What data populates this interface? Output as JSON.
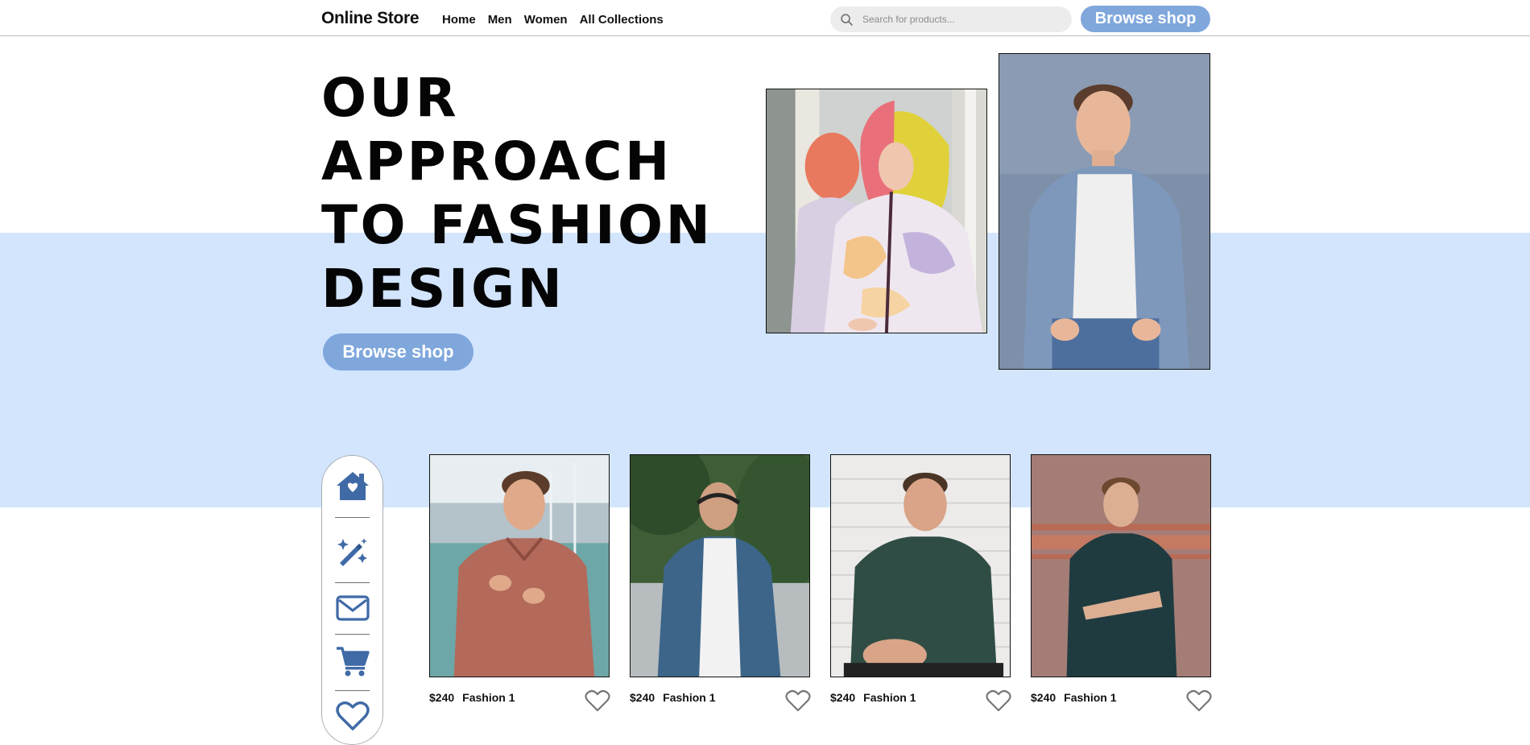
{
  "header": {
    "brand": "Online Store",
    "nav": [
      "Home",
      "Men",
      "Women",
      "All Collections"
    ],
    "search": {
      "placeholder": "Search for products...",
      "icon": "search-icon"
    },
    "cta_label": "Browse shop"
  },
  "hero": {
    "title_lines": [
      "OUR",
      "APPROACH",
      "TO FASHION",
      "DESIGN"
    ],
    "cta_label": "Browse shop",
    "photos": [
      "tie-dye-jacket-photo",
      "denim-shirt-man-photo"
    ]
  },
  "side_nav": {
    "items": [
      {
        "icon": "home-icon"
      },
      {
        "icon": "magic-wand-icon"
      },
      {
        "icon": "envelope-icon"
      },
      {
        "icon": "cart-icon"
      },
      {
        "icon": "heart-icon"
      }
    ]
  },
  "products": [
    {
      "price": "$240",
      "name": "Fashion 1",
      "photo": "red-polo-man-photo",
      "icon": "heart-outline-icon"
    },
    {
      "price": "$240",
      "name": "Fashion 1",
      "photo": "denim-jacket-man-photo",
      "icon": "heart-outline-icon"
    },
    {
      "price": "$240",
      "name": "Fashion 1",
      "photo": "green-henley-man-photo",
      "icon": "heart-outline-icon"
    },
    {
      "price": "$240",
      "name": "Fashion 1",
      "photo": "dark-tee-man-photo",
      "icon": "heart-outline-icon"
    }
  ],
  "colors": {
    "accent": "#7fa7dc",
    "hero_band": "#d2e5fd",
    "icon": "#3f6aa6",
    "text": "#111111"
  }
}
